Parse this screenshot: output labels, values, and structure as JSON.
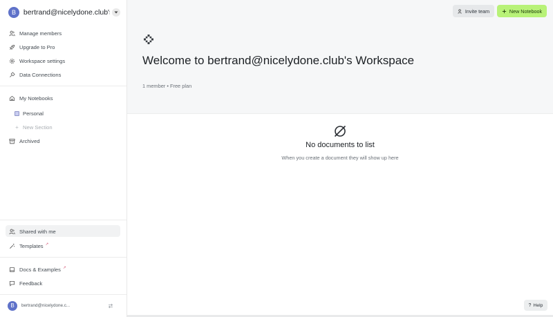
{
  "workspace": {
    "avatar_letter": "B",
    "name": "bertrand@nicelydone.club's ..."
  },
  "sidebar": {
    "menu": [
      {
        "label": "Manage members",
        "icon": "members-icon"
      },
      {
        "label": "Upgrade to Pro",
        "icon": "rocket-icon"
      },
      {
        "label": "Workspace settings",
        "icon": "gear-icon"
      },
      {
        "label": "Data Connections",
        "icon": "plug-icon"
      }
    ],
    "my_notebooks": "My Notebooks",
    "personal": "Personal",
    "new_section": "New Section",
    "archived": "Archived",
    "shared_with_me": "Shared with me",
    "templates": "Templates",
    "docs_examples": "Docs & Examples",
    "feedback": "Feedback",
    "user": {
      "avatar_letter": "B",
      "email": "bertrand@nicelydone.c..."
    }
  },
  "header": {
    "invite_label": "Invite team",
    "new_notebook_label": "New Notebook"
  },
  "hero": {
    "title": "Welcome to bertrand@nicelydone.club's Workspace",
    "meta": "1 member • Free plan"
  },
  "empty": {
    "title": "No documents to list",
    "subtitle": "When you create a document they will show up here"
  },
  "help_label": "Help",
  "colors": {
    "accent_green": "#b8f278",
    "avatar": "#5f72c9",
    "hero_bg": "#f6f7f8"
  }
}
